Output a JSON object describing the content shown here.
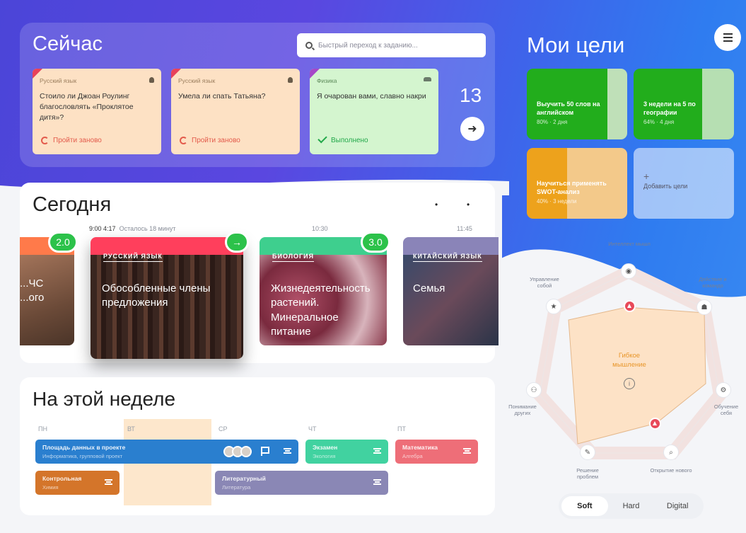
{
  "now": {
    "title": "Сейчас",
    "search_placeholder": "Быстрый переход к заданию...",
    "tasks": [
      {
        "subject": "Русский язык",
        "question": "Стоило ли Джоан Роулинг благословлять «Проклятое дитя»?",
        "action": "Пройти заново",
        "color": "#fde1c4"
      },
      {
        "subject": "Русский язык",
        "question": "Умела ли спать Татьяна?",
        "action": "Пройти заново",
        "color": "#fde1c4"
      },
      {
        "subject": "Физика",
        "question": "Я очарован вами, славно накри",
        "action": "Выполнено",
        "color": "#d4f5cf"
      }
    ],
    "count": "13"
  },
  "goals": {
    "title": "Мои цели",
    "items": [
      {
        "text": "Выучить 50 слов на английском",
        "sub": "80% · 2 дня",
        "fill": "#22ad1c",
        "rest": "#bfe0b8",
        "progress": 0.8
      },
      {
        "text": "3 недели на 5 по географии",
        "sub": "64% · 4 дня",
        "fill": "#22ad1c",
        "rest": "#b6dfb2",
        "progress": 0.68
      },
      {
        "text": "Научиться применять SWOT-анализ",
        "sub": "40% · 3 недели",
        "fill": "#eda21c",
        "rest": "#f3c98a",
        "progress": 0.4
      },
      {
        "text": "Добавить цели",
        "sub": ""
      }
    ]
  },
  "today": {
    "title": "Сегодня",
    "times": [
      {
        "time": "9:00 4:17",
        "note": "Осталось 18 минут"
      },
      {
        "time": "10:30",
        "note": ""
      },
      {
        "time": "11:45",
        "note": ""
      }
    ],
    "lessons": [
      {
        "label": "",
        "title": "...ЧС ...ого",
        "score": "2.0"
      },
      {
        "label": "РУССКИЙ ЯЗЫК",
        "title": "Обособленные члены предложения",
        "score": "→"
      },
      {
        "label": "БИОЛОГИЯ",
        "title": "Жизнедеятельность растений. Минеральное питание",
        "score": "3.0"
      },
      {
        "label": "КИТАЙСКИЙ ЯЗЫК",
        "title": "Семья",
        "score": ""
      }
    ]
  },
  "week": {
    "title": "На этой неделе",
    "days": [
      "ПН",
      "ВТ",
      "СР",
      "ЧТ",
      "ПТ"
    ],
    "events": [
      {
        "title": "Площадь данных в проекте",
        "sub": "Информатика, групповой проект",
        "color": "#2a7fcf"
      },
      {
        "title": "Экзамен",
        "sub": "Экология",
        "color": "#41d2a0"
      },
      {
        "title": "Математика",
        "sub": "Алгебра",
        "color": "#ee6e78"
      },
      {
        "title": "Контрольная",
        "sub": "Химия",
        "color": "#d4752a"
      },
      {
        "title": "Литературный",
        "sub": "Литература",
        "color": "#8a87b5"
      }
    ]
  },
  "radar": {
    "labels": [
      "Интеллект мышл",
      "Действие и командо",
      "Обучение себя",
      "Открытие нового",
      "Решение проблем",
      "Понимание других",
      "Управление собой"
    ],
    "center": "Гибкое мышление",
    "tabs": [
      "Soft",
      "Hard",
      "Digital"
    ],
    "active_tab": "Soft"
  }
}
